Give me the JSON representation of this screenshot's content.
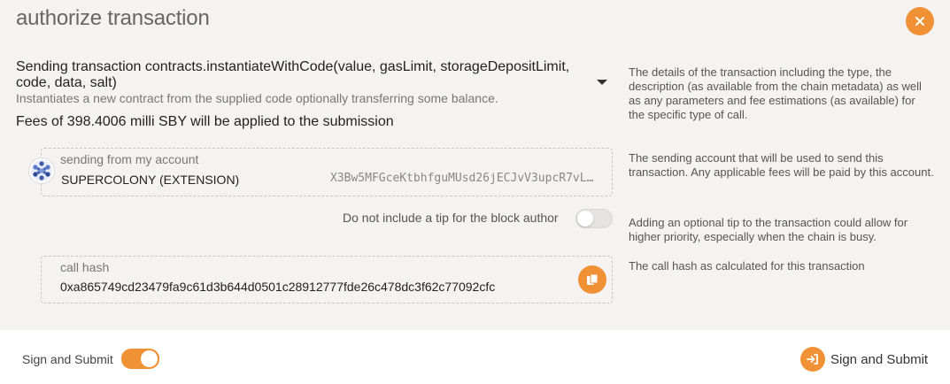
{
  "modal": {
    "title": "authorize transaction",
    "close_icon": "close-icon"
  },
  "transaction": {
    "heading": "Sending transaction contracts.instantiateWithCode(value, gasLimit, storageDepositLimit, code, data, salt)",
    "description": "Instantiates a new contract from the supplied code optionally transferring some balance.",
    "fees": "Fees of 398.4006 milli SBY will be applied to the submission",
    "help": "The details of the transaction including the type, the description (as available from the chain metadata) as well as any parameters and fee estimations (as available) for the specific type of call."
  },
  "account": {
    "label": "sending from my account",
    "name": "SUPERCOLONY (EXTENSION)",
    "address": "X3Bw5MFGceKtbhfguMUsd26jECJvV3upcR7vL…",
    "help": "The sending account that will be used to send this transaction. Any applicable fees will be paid by this account."
  },
  "tip": {
    "label": "Do not include a tip for the block author",
    "enabled": false,
    "help": "Adding an optional tip to the transaction could allow for higher priority, especially when the chain is busy."
  },
  "call_hash": {
    "label": "call hash",
    "value": "0xa865749cd23479fa9c61d3b644d0501c28912777fde26c478dc3f62c77092cfc",
    "help": "The call hash as calculated for this transaction"
  },
  "footer": {
    "toggle_label": "Sign and Submit",
    "toggle_enabled": true,
    "submit_label": "Sign and Submit"
  },
  "colors": {
    "accent": "#f19135",
    "background": "#f5f3f1"
  }
}
